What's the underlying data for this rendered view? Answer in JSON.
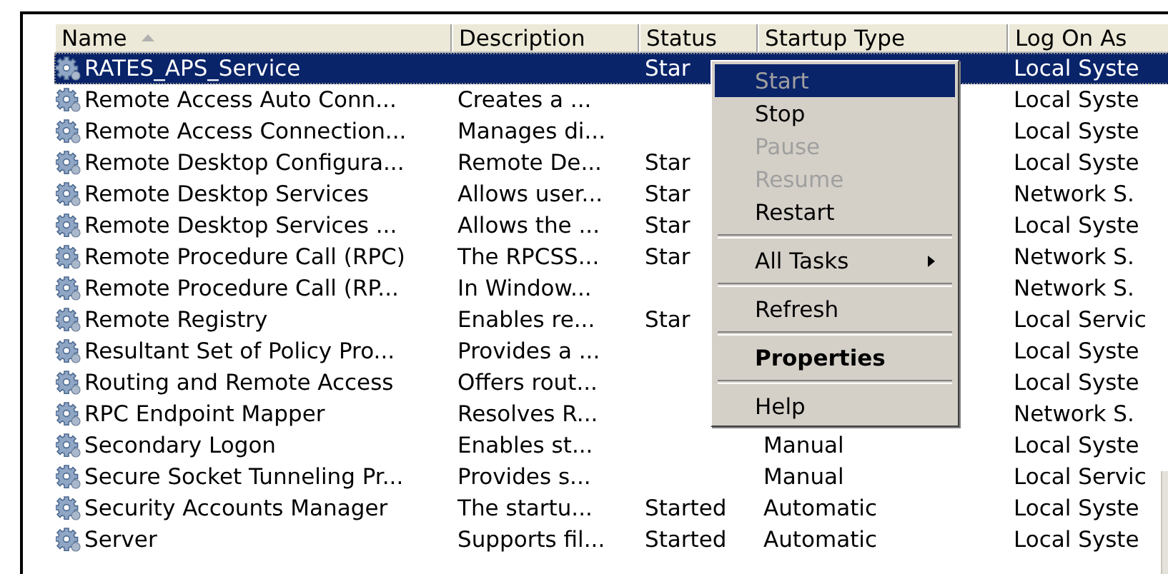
{
  "table": {
    "columns": [
      {
        "label": "Name",
        "sorted": true
      },
      {
        "label": "Description",
        "sorted": false
      },
      {
        "label": "Status",
        "sorted": false
      },
      {
        "label": "Startup Type",
        "sorted": false
      },
      {
        "label": "Log On As",
        "sorted": false
      }
    ],
    "rows": [
      {
        "name": "RATES_APS_Service",
        "description": "",
        "status": "Star",
        "startup": "",
        "logon": "Local Syste",
        "selected": true
      },
      {
        "name": "Remote Access Auto Conn...",
        "description": "Creates a ...",
        "status": "",
        "startup": "",
        "logon": "Local Syste",
        "selected": false
      },
      {
        "name": "Remote Access Connection...",
        "description": "Manages di...",
        "status": "",
        "startup": "",
        "logon": "Local Syste",
        "selected": false
      },
      {
        "name": "Remote Desktop Configura...",
        "description": "Remote De...",
        "status": "Star",
        "startup": "",
        "logon": "Local Syste",
        "selected": false
      },
      {
        "name": "Remote Desktop Services",
        "description": "Allows user...",
        "status": "Star",
        "startup": "",
        "logon": "Network S.",
        "selected": false
      },
      {
        "name": "Remote Desktop Services ...",
        "description": "Allows the ...",
        "status": "Star",
        "startup": "",
        "logon": "Local Syste",
        "selected": false
      },
      {
        "name": "Remote Procedure Call (RPC)",
        "description": "The RPCSS...",
        "status": "Star",
        "startup": "",
        "logon": "Network S.",
        "selected": false
      },
      {
        "name": "Remote Procedure Call (RP...",
        "description": "In Window...",
        "status": "",
        "startup": "",
        "logon": "Network S.",
        "selected": false
      },
      {
        "name": "Remote Registry",
        "description": "Enables re...",
        "status": "Star",
        "startup": "",
        "logon": "Local Servic",
        "selected": false
      },
      {
        "name": "Resultant Set of Policy Pro...",
        "description": "Provides a ...",
        "status": "",
        "startup": "",
        "logon": "Local Syste",
        "selected": false
      },
      {
        "name": "Routing and Remote Access",
        "description": "Offers rout...",
        "status": "",
        "startup": "",
        "logon": "Local Syste",
        "selected": false
      },
      {
        "name": "RPC Endpoint Mapper",
        "description": "Resolves R...",
        "status": "",
        "startup": "",
        "logon": "Network S.",
        "selected": false
      },
      {
        "name": "Secondary Logon",
        "description": "Enables st...",
        "status": "",
        "startup": "Manual",
        "logon": "Local Syste",
        "selected": false
      },
      {
        "name": "Secure Socket Tunneling Pr...",
        "description": "Provides s...",
        "status": "",
        "startup": "Manual",
        "logon": "Local Servic",
        "selected": false
      },
      {
        "name": "Security Accounts Manager",
        "description": "The startu...",
        "status": "Started",
        "startup": "Automatic",
        "logon": "Local Syste",
        "selected": false
      },
      {
        "name": "Server",
        "description": "Supports fil...",
        "status": "Started",
        "startup": "Automatic",
        "logon": "Local Syste",
        "selected": false
      }
    ]
  },
  "context_menu": {
    "items": [
      {
        "kind": "item",
        "label": "Start",
        "disabled": true,
        "selected": true,
        "bold": false
      },
      {
        "kind": "item",
        "label": "Stop",
        "disabled": false,
        "selected": false,
        "bold": false
      },
      {
        "kind": "item",
        "label": "Pause",
        "disabled": true,
        "selected": false,
        "bold": false
      },
      {
        "kind": "item",
        "label": "Resume",
        "disabled": true,
        "selected": false,
        "bold": false
      },
      {
        "kind": "item",
        "label": "Restart",
        "disabled": false,
        "selected": false,
        "bold": false
      },
      {
        "kind": "separator"
      },
      {
        "kind": "submenu",
        "label": "All Tasks",
        "disabled": false,
        "selected": false,
        "bold": false
      },
      {
        "kind": "separator"
      },
      {
        "kind": "item",
        "label": "Refresh",
        "disabled": false,
        "selected": false,
        "bold": false
      },
      {
        "kind": "separator"
      },
      {
        "kind": "item",
        "label": "Properties",
        "disabled": false,
        "selected": false,
        "bold": true
      },
      {
        "kind": "separator"
      },
      {
        "kind": "item",
        "label": "Help",
        "disabled": false,
        "selected": false,
        "bold": false
      }
    ]
  }
}
